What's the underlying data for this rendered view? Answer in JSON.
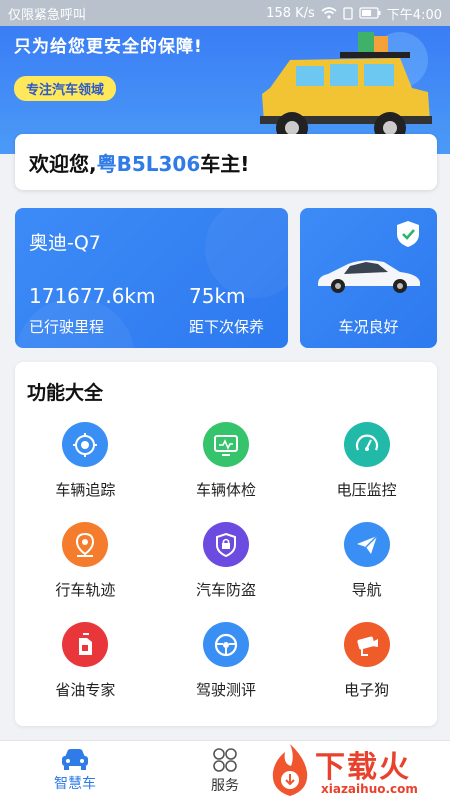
{
  "status_bar": {
    "left": "仅限紧急呼叫",
    "speed": "158 K/s",
    "time": "下午4:00",
    "icons": [
      "wifi-icon",
      "sim-icon",
      "battery-icon"
    ]
  },
  "banner": {
    "slogan": "只为给您更安全的保障!",
    "tag": "专注汽车领域"
  },
  "welcome": {
    "prefix": "欢迎您,",
    "plate": "粤B5L306",
    "suffix": "车主!"
  },
  "vehicle": {
    "model": "奥迪-Q7",
    "mileage": "171677.6km",
    "mileage_label": "已行驶里程",
    "next_service": "75km",
    "next_service_label": "距下次保养",
    "condition_label": "车况良好"
  },
  "features": {
    "title": "功能大全",
    "items": [
      {
        "label": "车辆追踪",
        "icon": "target-icon",
        "color": "#3a8ff5"
      },
      {
        "label": "车辆体检",
        "icon": "monitor-icon",
        "color": "#35c36b"
      },
      {
        "label": "电压监控",
        "icon": "gauge-icon",
        "color": "#21b9a8"
      },
      {
        "label": "行车轨迹",
        "icon": "location-pin-icon",
        "color": "#f57c2c"
      },
      {
        "label": "汽车防盗",
        "icon": "lock-icon",
        "color": "#6b4be0"
      },
      {
        "label": "导航",
        "icon": "paper-plane-icon",
        "color": "#3a8ff5"
      },
      {
        "label": "省油专家",
        "icon": "fuel-can-icon",
        "color": "#e8363a"
      },
      {
        "label": "驾驶测评",
        "icon": "steering-wheel-icon",
        "color": "#3a8ff5"
      },
      {
        "label": "电子狗",
        "icon": "camera-icon",
        "color": "#f05b2a"
      }
    ]
  },
  "tabbar": {
    "tab1": "智慧车",
    "tab2": "服务"
  },
  "watermark": {
    "text": "下载火",
    "url": "xiazaihuo.com"
  },
  "colors": {
    "accent": "#2f7be8",
    "card": "#3d8bf7"
  }
}
